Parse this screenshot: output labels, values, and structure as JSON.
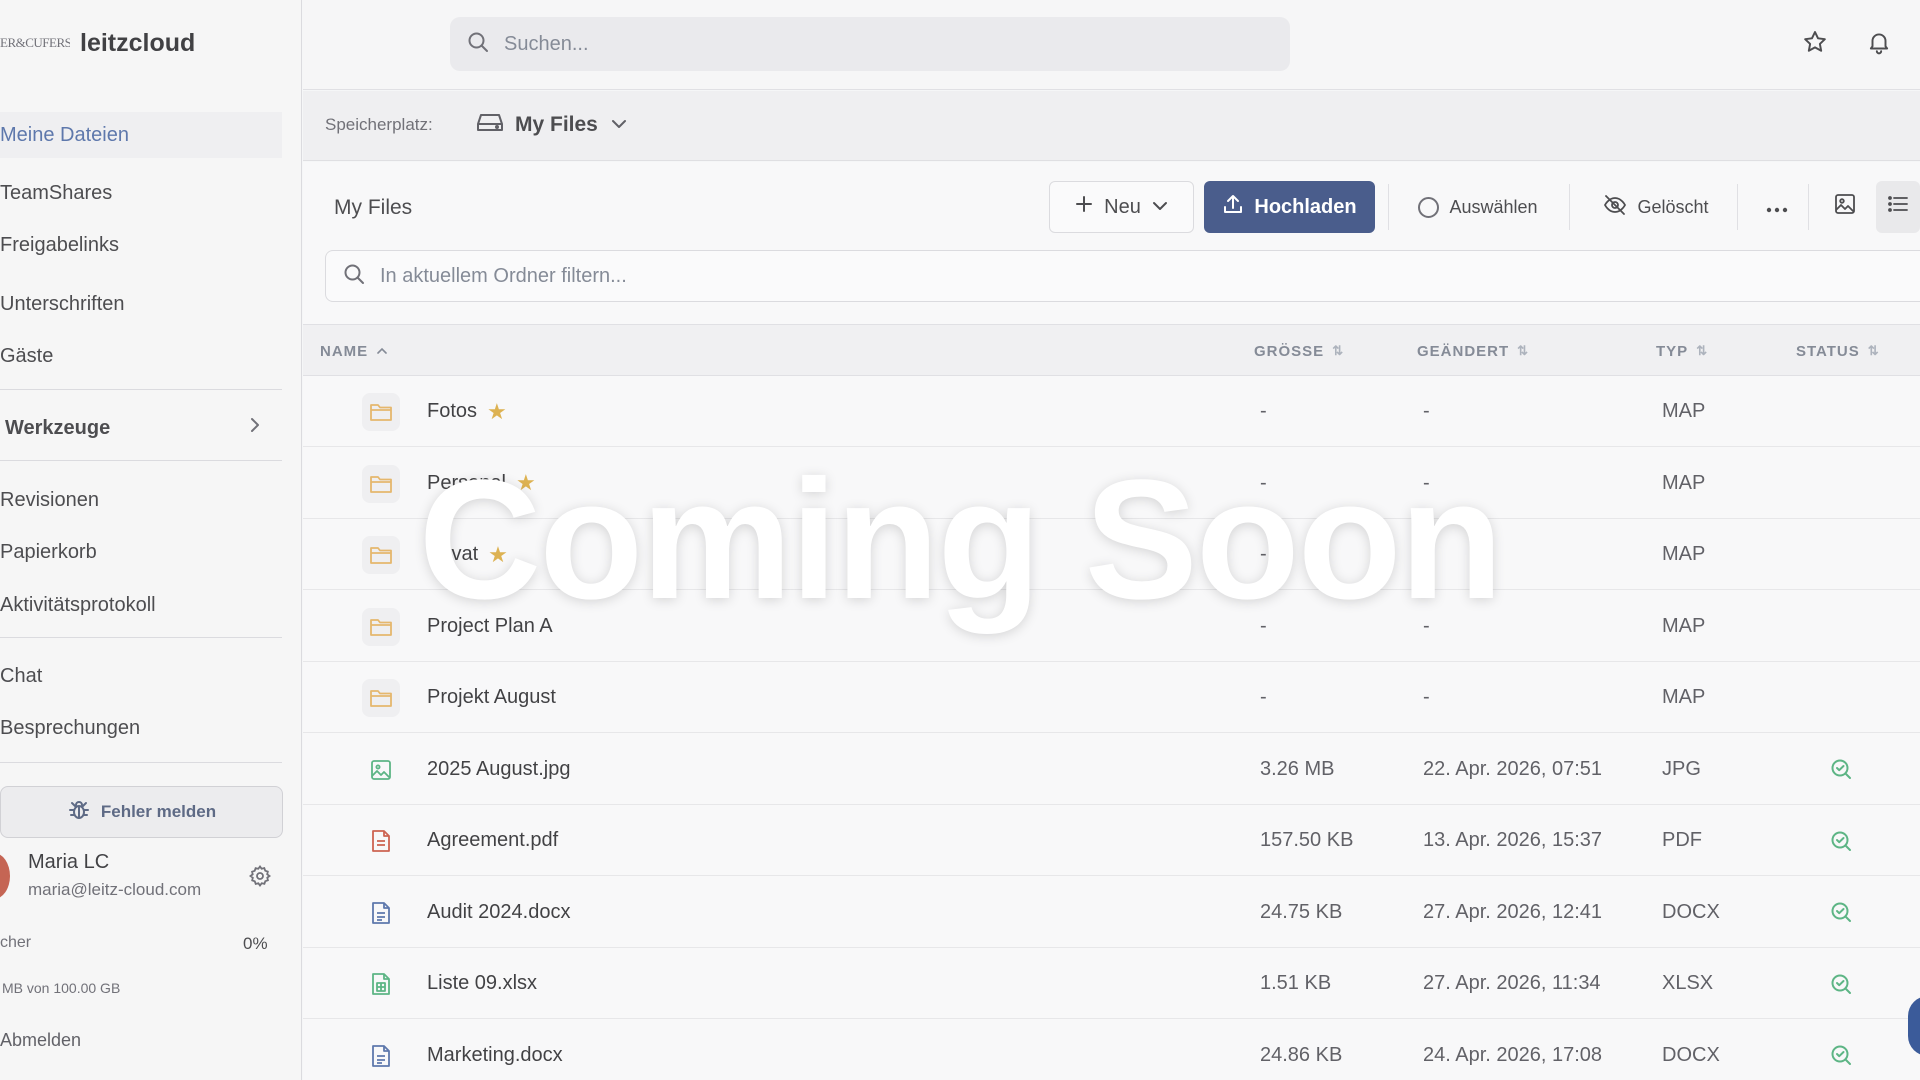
{
  "brand": {
    "logo_text": "ER&CUFERS",
    "name": "leitzcloud"
  },
  "sidebar": {
    "items": [
      {
        "label": "Meine Dateien"
      },
      {
        "label": "TeamShares"
      },
      {
        "label": "Freigabelinks"
      },
      {
        "label": "Unterschriften"
      },
      {
        "label": "Gäste"
      },
      {
        "label": "Werkzeuge"
      },
      {
        "label": "Revisionen"
      },
      {
        "label": "Papierkorb"
      },
      {
        "label": "Aktivitätsprotokoll"
      },
      {
        "label": "Chat"
      },
      {
        "label": "Besprechungen"
      }
    ],
    "bug_button": "Fehler melden",
    "user": {
      "name": "Maria LC",
      "email": "maria@leitz-cloud.com"
    },
    "storage": {
      "label": "cher",
      "percent": "0%",
      "detail": "MB von 100.00 GB"
    },
    "logout": "Abmelden"
  },
  "topbar": {
    "search_placeholder": "Suchen..."
  },
  "location": {
    "label": "Speicherplatz:",
    "value": "My Files"
  },
  "toolbar": {
    "title": "My Files",
    "new_label": "Neu",
    "upload_label": "Hochladen",
    "select_label": "Auswählen",
    "deleted_label": "Gelöscht"
  },
  "filter": {
    "placeholder": "In aktuellem Ordner filtern..."
  },
  "table": {
    "headers": {
      "name": "NAME",
      "size": "GRÖSSE",
      "modified": "GEÄNDERT",
      "type": "TYP",
      "status": "STATUS"
    },
    "rows": [
      {
        "name": "Fotos",
        "size": "-",
        "modified": "-",
        "type": "MAP",
        "kind": "folder",
        "starred": true
      },
      {
        "name": "Personal",
        "size": "-",
        "modified": "-",
        "type": "MAP",
        "kind": "folder",
        "starred": true
      },
      {
        "name": "Privat",
        "size": "-",
        "modified": "-",
        "type": "MAP",
        "kind": "folder",
        "starred": true
      },
      {
        "name": "Project Plan A",
        "size": "-",
        "modified": "-",
        "type": "MAP",
        "kind": "folder",
        "starred": false
      },
      {
        "name": "Projekt August",
        "size": "-",
        "modified": "-",
        "type": "MAP",
        "kind": "folder",
        "starred": false
      },
      {
        "name": "2025 August.jpg",
        "size": "3.26 MB",
        "modified": "22. Apr. 2026, 07:51",
        "type": "JPG",
        "kind": "image",
        "starred": false
      },
      {
        "name": "Agreement.pdf",
        "size": "157.50 KB",
        "modified": "13. Apr. 2026, 15:37",
        "type": "PDF",
        "kind": "pdf",
        "starred": false
      },
      {
        "name": "Audit 2024.docx",
        "size": "24.75 KB",
        "modified": "27. Apr. 2026, 12:41",
        "type": "DOCX",
        "kind": "doc",
        "starred": false
      },
      {
        "name": "Liste 09.xlsx",
        "size": "1.51 KB",
        "modified": "27. Apr. 2026, 11:34",
        "type": "XLSX",
        "kind": "sheet",
        "starred": false
      },
      {
        "name": "Marketing.docx",
        "size": "24.86 KB",
        "modified": "24. Apr. 2026, 17:08",
        "type": "DOCX",
        "kind": "doc",
        "starred": false
      }
    ]
  },
  "overlay": {
    "text": "Coming Soon"
  },
  "colors": {
    "primary": "#233a73",
    "accent": "#3b5b9a",
    "folder": "#e0a84e",
    "star": "#d6a22c",
    "status_ok": "#3aa56b"
  }
}
